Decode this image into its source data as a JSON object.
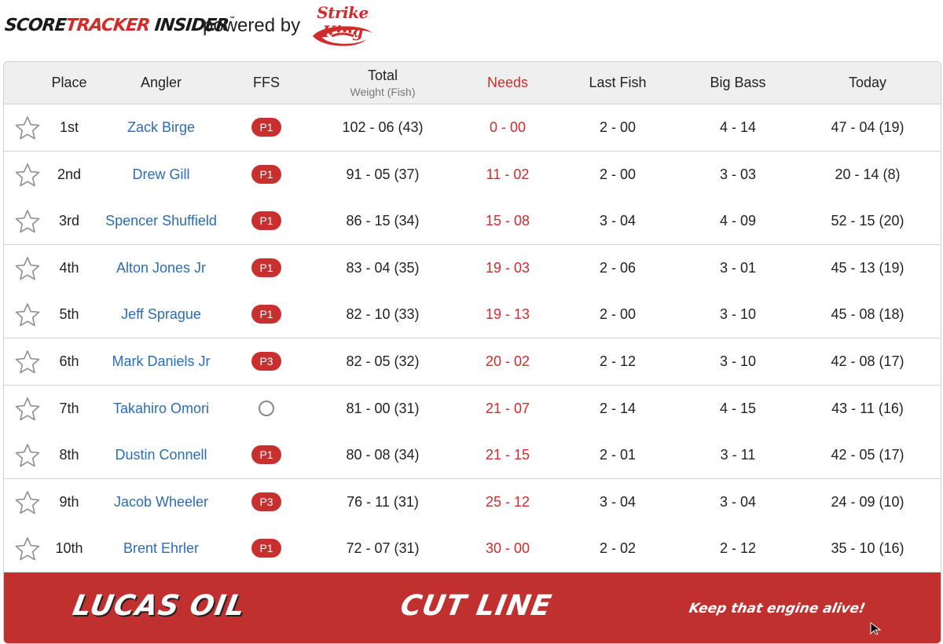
{
  "header": {
    "brand_score": "SCORE",
    "brand_tracker": "TRACKER",
    "brand_insider": " INSIDER",
    "brand_tm": "™",
    "powered_by": "powered by",
    "sponsor": "Strike King"
  },
  "columns": {
    "place": "Place",
    "angler": "Angler",
    "ffs": "FFS",
    "total": "Total",
    "total_sub": "Weight (Fish)",
    "needs": "Needs",
    "last_fish": "Last Fish",
    "big_bass": "Big Bass",
    "today": "Today"
  },
  "rows": [
    {
      "place": "1st",
      "angler": "Zack Birge",
      "ffs": "P1",
      "total": "102 - 06 (43)",
      "needs": "0 - 00",
      "last_fish": "2 - 00",
      "big_bass": "4 - 14",
      "today": "47 - 04 (19)"
    },
    {
      "place": "2nd",
      "angler": "Drew Gill",
      "ffs": "P1",
      "total": "91 - 05 (37)",
      "needs": "11 - 02",
      "last_fish": "2 - 00",
      "big_bass": "3 - 03",
      "today": "20 - 14 (8)"
    },
    {
      "place": "3rd",
      "angler": "Spencer Shuffield",
      "ffs": "P1",
      "total": "86 - 15 (34)",
      "needs": "15 - 08",
      "last_fish": "3 - 04",
      "big_bass": "4 - 09",
      "today": "52 - 15 (20)"
    },
    {
      "place": "4th",
      "angler": "Alton Jones Jr",
      "ffs": "P1",
      "total": "83 - 04 (35)",
      "needs": "19 - 03",
      "last_fish": "2 - 06",
      "big_bass": "3 - 01",
      "today": "45 - 13 (19)"
    },
    {
      "place": "5th",
      "angler": "Jeff Sprague",
      "ffs": "P1",
      "total": "82 - 10 (33)",
      "needs": "19 - 13",
      "last_fish": "2 - 00",
      "big_bass": "3 - 10",
      "today": "45 - 08 (18)"
    },
    {
      "place": "6th",
      "angler": "Mark Daniels Jr",
      "ffs": "P3",
      "total": "82 - 05 (32)",
      "needs": "20 - 02",
      "last_fish": "2 - 12",
      "big_bass": "3 - 10",
      "today": "42 - 08 (17)"
    },
    {
      "place": "7th",
      "angler": "Takahiro Omori",
      "ffs": "",
      "total": "81 - 00 (31)",
      "needs": "21 - 07",
      "last_fish": "2 - 14",
      "big_bass": "4 - 15",
      "today": "43 - 11 (16)"
    },
    {
      "place": "8th",
      "angler": "Dustin Connell",
      "ffs": "P1",
      "total": "80 - 08 (34)",
      "needs": "21 - 15",
      "last_fish": "2 - 01",
      "big_bass": "3 - 11",
      "today": "42 - 05 (17)"
    },
    {
      "place": "9th",
      "angler": "Jacob Wheeler",
      "ffs": "P3",
      "total": "76 - 11 (31)",
      "needs": "25 - 12",
      "last_fish": "3 - 04",
      "big_bass": "3 - 04",
      "today": "24 - 09 (10)"
    },
    {
      "place": "10th",
      "angler": "Brent Ehrler",
      "ffs": "P1",
      "total": "72 - 07 (31)",
      "needs": "30 - 00",
      "last_fish": "2 - 02",
      "big_bass": "2 - 12",
      "today": "35 - 10 (16)"
    }
  ],
  "cutline": {
    "brand": "LUCAS OIL",
    "title": "CUT LINE",
    "tagline": "Keep that engine alive!"
  },
  "icons": {
    "favorite": "star-outline-icon",
    "ffs_none": "circle-outline-icon",
    "cursor": "mouse-pointer-icon"
  },
  "colors": {
    "accent_red": "#c8302f",
    "needs_red": "#d22b2b",
    "angler_blue": "#2a6db5",
    "header_bg": "#efefef"
  }
}
